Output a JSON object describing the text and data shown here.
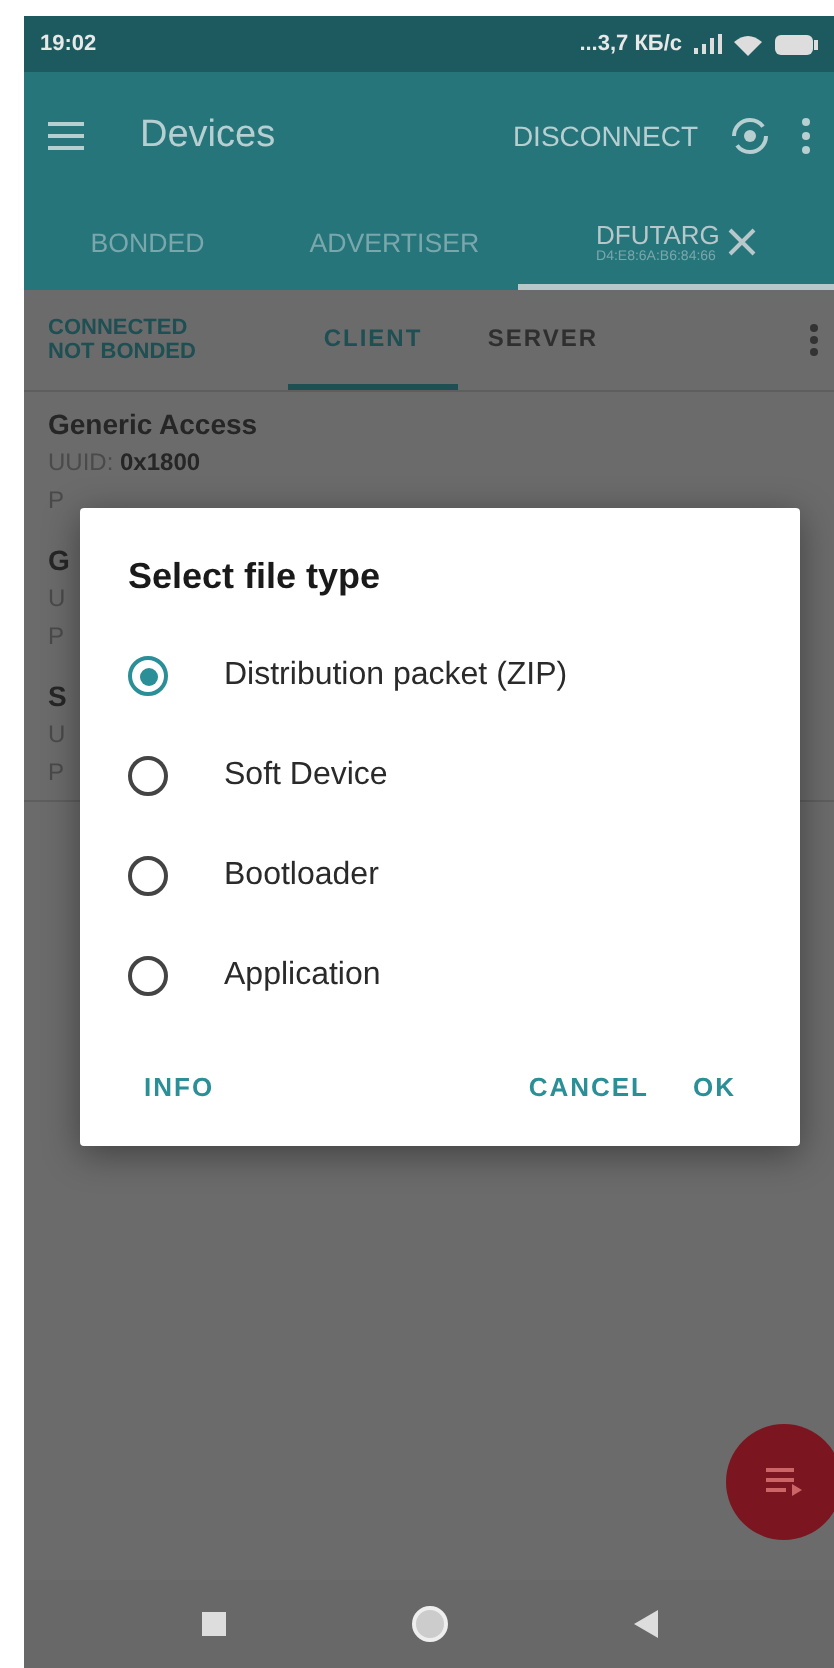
{
  "status_bar": {
    "time": "19:02",
    "network_speed": "...3,7 КБ/с"
  },
  "app_bar": {
    "title": "Devices",
    "action": "DISCONNECT"
  },
  "tabs": [
    {
      "label": "BONDED",
      "selected": false
    },
    {
      "label": "ADVERTISER",
      "selected": false
    },
    {
      "label": "DFUTARG",
      "subtitle": "D4:E8:6A:B6:84:66",
      "selected": true,
      "closable": true
    }
  ],
  "connection": {
    "state": "CONNECTED",
    "bond": "NOT BONDED"
  },
  "sub_tabs": [
    {
      "label": "CLIENT",
      "selected": true
    },
    {
      "label": "SERVER",
      "selected": false
    }
  ],
  "services": [
    {
      "name": "Generic Access",
      "uuid": "UUID: **0x1800**",
      "properties": "P"
    },
    {
      "name": "G",
      "uuid": "U",
      "properties": "P"
    },
    {
      "name": "S",
      "uuid": "U",
      "properties": "P"
    }
  ],
  "dialog": {
    "title": "Select file type",
    "options": [
      {
        "label": "Distribution packet (ZIP)",
        "selected": true
      },
      {
        "label": "Soft Device",
        "selected": false
      },
      {
        "label": "Bootloader",
        "selected": false
      },
      {
        "label": "Application",
        "selected": false
      }
    ],
    "buttons": [
      {
        "label": "INFO",
        "kind": "left"
      },
      {
        "label": "CANCEL",
        "kind": "right"
      },
      {
        "label": "OK",
        "kind": "right"
      }
    ]
  }
}
